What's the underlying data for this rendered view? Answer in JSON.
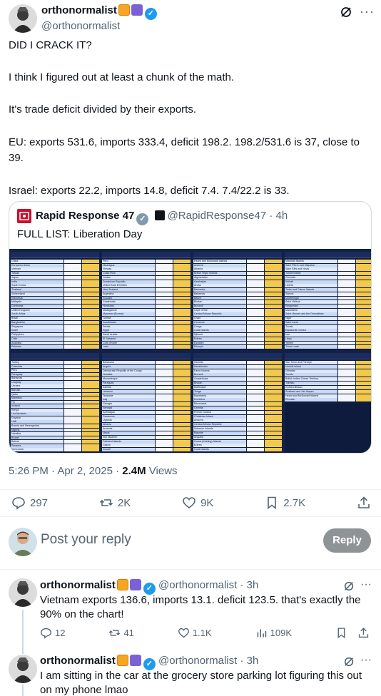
{
  "main_tweet": {
    "name": "orthonormalist",
    "handle": "@orthonormalist",
    "text_lines": [
      "DID I CRACK IT?",
      "",
      "I think I figured out at least a chunk of the math.",
      "",
      "It's trade deficit divided by their exports.",
      "",
      "EU: exports 531.6, imports 333.4, deficit 198.2. 198.2/531.6 is 37, close to 39.",
      "",
      "Israel: exports 22.2, imports 14.8, deficit 7.4. 7.4/22.2 is 33."
    ],
    "timestamp": "5:26 PM · Apr 2, 2025 · ",
    "views_count": "2.4M",
    "views_label": " Views",
    "stats": {
      "replies": "297",
      "reposts": "2K",
      "likes": "9K",
      "bookmarks": "2.7K"
    }
  },
  "quote": {
    "name": "Rapid Response 47",
    "handle": "@RapidResponse47 · 4h",
    "text": "FULL LIST: Liberation Day"
  },
  "sheet": {
    "top_row": {
      "col1": [
        "China",
        "European Union",
        "Vietnam",
        "Taiwan",
        "Japan",
        "India",
        "South Korea",
        "Thailand",
        "Switzerland",
        "Indonesia",
        "Malaysia",
        "Cambodia",
        "United Kingdom",
        "South Africa",
        "Brazil",
        "Bangladesh",
        "Singapore",
        "Israel",
        "Philippines",
        "Chile",
        "Australia",
        "Pakistan"
      ],
      "col2": [
        "Peru",
        "Nicaragua",
        "Norway",
        "Costa Rica",
        "Jordan",
        "Dominican Republic",
        "United Arab Emirates",
        "New Zealand",
        "Argentina",
        "Ecuador",
        "Guatemala",
        "Honduras",
        "Madagascar",
        "Myanmar (Burma)",
        "Tunisia",
        "Kazakhstan",
        "Serbia",
        "Egypt",
        "Saudi Arabia",
        "El Salvador",
        "Cote d'Ivoire",
        "Laos"
      ],
      "col3": [
        "Heard and McDonald Islands",
        "Andorra",
        "Albania",
        "British Virgin Islands",
        "Afghanistan",
        "Azerbaijan",
        "Aruba",
        "Barbados",
        "Bahamas",
        "Belize",
        "Bhutan",
        "Burundi",
        "Cape Verde",
        "Central African Republic",
        "Chad",
        "Comoros",
        "Congo",
        "Cook Islands",
        "Djibouti",
        "Eritrea",
        "Eswatini",
        "Ethiopia"
      ],
      "col4": [
        "Marshall Islands",
        "Saint Pierre and Miquelon",
        "Saint Kitts and Nevis",
        "Turkmenistan",
        "Grenada",
        "Kiribati",
        "Liberia",
        "Turks and Caicos Islands",
        "Samoa",
        "Montenegro",
        "Saint Helena",
        "Kyrgyzstan",
        "Mauritania",
        "Saint Vincent and the Grenadines",
        "Niger",
        "Saint Lucia",
        "Tuvalu",
        "Equatorial Guinea",
        "Iran",
        "Libya",
        "Yemen",
        "Timor-Leste"
      ]
    },
    "bottom_row": {
      "col1": [
        "Turkey",
        "Colombia",
        "Peru",
        "Paraguay",
        "Bahamas",
        "Uruguay",
        "Ukraine",
        "Bahrain",
        "Qatar",
        "Mauritius",
        "Fiji",
        "Iceland",
        "Kenya",
        "Liechtenstein",
        "Guyana",
        "Haiti",
        "Bosnia and Herzegovina",
        "Nigeria",
        "Namibia",
        "Brunei",
        "Bolivia",
        "Panama",
        "Venezuela"
      ],
      "col2": [
        "Botswana",
        "Angola",
        "Democratic Republic of the Congo",
        "Jamaica",
        "Mozambique",
        "Paraguay",
        "Zambia",
        "Lebanon",
        "Tanzania",
        "Iraq",
        "Georgia",
        "Senegal",
        "Azerbaijan",
        "Cameroon",
        "Uganda",
        "Albania",
        "Armenia",
        "Nepal",
        "Sint Maarten",
        "Falkland Islands",
        "Gabon",
        "Kuwait"
      ],
      "col3": [
        "Gambia",
        "Kazakhstan",
        "Faroe Islands",
        "Burundi",
        "Guadeloupe",
        "Bhutan",
        "Martinique",
        "Tonga",
        "Mauritania",
        "Dominica",
        "Micronesia",
        "Gambia",
        "French Guiana",
        "Christmas Island",
        "Andorra",
        "Central African Republic",
        "Solomon Islands",
        "Mayotte",
        "Anguilla",
        "Cocos (Keeling) Islands",
        "Eritrea",
        "Cook Islands"
      ],
      "col4": [
        "Sao Tome and Principe",
        "Norfolk Island",
        "Gibraltar",
        "Tuvalu",
        "British Indian Ocean Territory",
        "Tokelau",
        "Guinea-Bissau",
        "Svalbard and Jan Mayen",
        "Heard and McDonald Islands",
        "Reunion"
      ]
    }
  },
  "compose": {
    "placeholder": "Post your reply",
    "button_label": "Reply"
  },
  "replies": [
    {
      "name": "orthonormalist",
      "handle": "@orthonormalist · 3h",
      "text": "Vietnam exports 136.6, imports 13.1. deficit 123.5. that's exactly the 90% on the chart!",
      "stats": {
        "replies": "12",
        "reposts": "41",
        "likes": "1.1K",
        "views": "109K"
      }
    },
    {
      "name": "orthonormalist",
      "handle": "@orthonormalist · 3h",
      "text": "I am sitting in the car at the grocery store parking lot figuring this out on my phone lmao"
    }
  ],
  "colors": {
    "accent": "#1d9bf0",
    "sheet_bg": "#12214a",
    "sheet_highlight": "#f2c94c"
  }
}
